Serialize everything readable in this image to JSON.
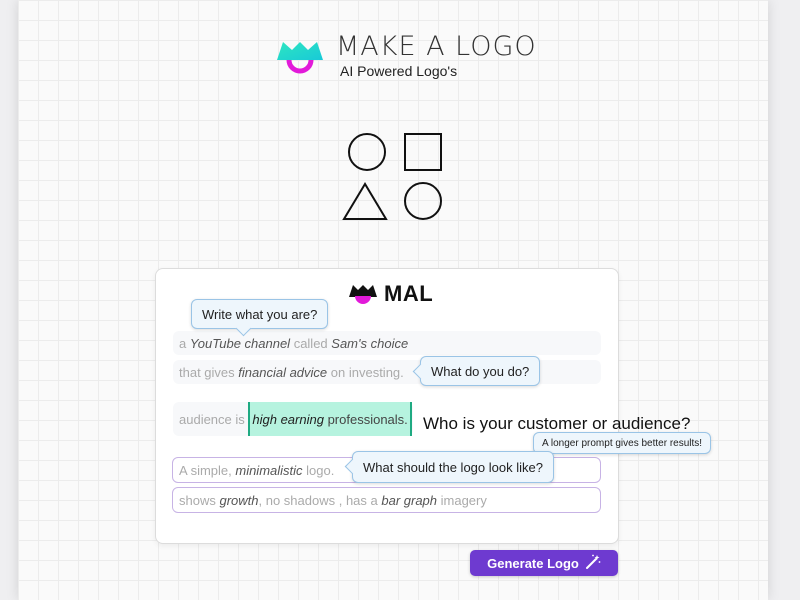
{
  "brand": {
    "title": "MAKE A LOGO",
    "subtitle": "AI Powered Logo's",
    "colors": {
      "cyan": "#2ee6c0",
      "magenta": "#e21ad9"
    }
  },
  "card": {
    "brand_short": "MAL",
    "rows": [
      {
        "parts": [
          {
            "t": "a ",
            "em": false
          },
          {
            "t": "YouTube channel",
            "em": true
          },
          {
            "t": " called ",
            "em": false
          },
          {
            "t": "Sam's choice",
            "em": true
          }
        ]
      },
      {
        "parts": [
          {
            "t": "that gives ",
            "em": false
          },
          {
            "t": "financial advice",
            "em": true
          },
          {
            "t": " on investing.",
            "em": false
          }
        ]
      },
      {
        "prefix": "audience is ",
        "highlight_em": "high earning",
        "highlight_rest": " professionals."
      },
      {
        "parts": [
          {
            "t": "A simple, ",
            "em": false
          },
          {
            "t": "minimalistic",
            "em": true
          },
          {
            "t": " logo.",
            "em": false
          }
        ]
      },
      {
        "parts": [
          {
            "t": "shows ",
            "em": false
          },
          {
            "t": "growth",
            "em": true
          },
          {
            "t": ", no shadows , has a ",
            "em": false
          },
          {
            "t": "bar graph",
            "em": true
          },
          {
            "t": " imagery",
            "em": false
          }
        ]
      }
    ]
  },
  "tooltips": {
    "what_are": "Write what you are?",
    "what_do": "What do you do?",
    "longer": "A longer prompt gives better results!",
    "look_like": "What should the logo look like?"
  },
  "question": "Who is your customer or audience?",
  "generate_button": {
    "label": "Generate Logo",
    "icon": "magic-wand-icon"
  },
  "accent": "#6e3ad0"
}
